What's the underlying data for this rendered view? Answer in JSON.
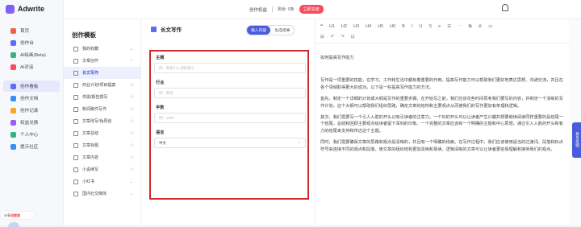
{
  "app": {
    "name": "Adwrite"
  },
  "sidebar": {
    "items": [
      {
        "label": "首页",
        "color": "#f0623f"
      },
      {
        "label": "创作台",
        "color": "#5b6cf6"
      },
      {
        "label": "AI绘画(Beta)",
        "color": "#36b37e"
      },
      {
        "label": "AI对话",
        "color": "#f64c5c"
      },
      {
        "label": "创作看板",
        "color": "#5b6cf6"
      },
      {
        "label": "创作文档",
        "color": "#3a8df6"
      },
      {
        "label": "创作记录",
        "color": "#f5a623"
      },
      {
        "label": "权益兑换",
        "color": "#9c5bf6"
      },
      {
        "label": "个人中心",
        "color": "#36b37e"
      },
      {
        "label": "提示社区",
        "color": "#3a8df6"
      }
    ],
    "promo": {
      "prefix": "分享",
      "highlight": "送额度"
    }
  },
  "topbar": {
    "rights_label": "创作权益",
    "remaining_label": "剩余",
    "remaining_value": "0条",
    "cta": "立即充值"
  },
  "templates": {
    "title": "创作模板",
    "items": [
      {
        "label": "我的收藏",
        "type": "fav"
      },
      {
        "label": "文章创作",
        "type": "group"
      },
      {
        "label": "长文写作",
        "type": "active"
      },
      {
        "label": "商业计划/项目提案",
        "type": "star"
      },
      {
        "label": "供需/报告撰写",
        "type": "star"
      },
      {
        "label": "新闻稿件写作",
        "type": "star"
      },
      {
        "label": "文章改写/伪原创",
        "type": "star"
      },
      {
        "label": "文章总结",
        "type": "star"
      },
      {
        "label": "文章标题",
        "type": "star"
      },
      {
        "label": "文章内容",
        "type": "star"
      },
      {
        "label": "小说续写",
        "type": "star"
      },
      {
        "label": "小红书",
        "type": "group"
      },
      {
        "label": "国内社交媒体",
        "type": "group"
      }
    ]
  },
  "form": {
    "title": "长文写作",
    "tabs": [
      "输入内容",
      "生成结果"
    ],
    "fields": [
      {
        "label": "主题",
        "placeholder": "例：教育引入调的意义"
      },
      {
        "label": "行业",
        "placeholder": "例：教育"
      },
      {
        "label": "字数",
        "placeholder": "例：1000"
      },
      {
        "label": "语言",
        "value": "中文"
      }
    ]
  },
  "editor": {
    "toolbar1": [
      "❝",
      "H1",
      "H2",
      "H3",
      "H4",
      "H5",
      "H6",
      "B",
      "I",
      "U",
      "S",
      "≡",
      "☰",
      "⋯",
      "⧉",
      "⊘",
      "▭"
    ],
    "toolbar2": [
      "⊟",
      "↶",
      "↷",
      "⊡"
    ],
    "title": "如何提高写作能力",
    "paragraphs": [
      "写作是一项重要的技能，在学习、工作和生活中都有着重要的作用。提高写作能力可以帮助我们更好地表达思想、沟通交流，并且在各个领域取得更大的成功。以下是一些提高写作能力的方法。",
      "首先，制定一个详细的计划或大纲是写作的重要步骤。在开始写之前，我们应该花些时间思考我们要写的内容，并制定一个清晰的写作计划。这个大纲可以帮助我们组织思路，确定文章的结构和主要观点从而使我们的写作更加有条理和逻辑。",
      "其次，我们需要写一个引人入胜的开头以吸引读者的注意力。一个好的开头可以让读者产生兴趣并想要继续阅读同样重要的是结尾一个结尾，总结和回顾主要观点给读者留下深刻的印象。一个完整的文章应该有一个明确的主题和中心思想，通过引人入胜的开头和有力的结尾来支持和传达这个主题。",
      "同时，我们需要确保文章的思路和观点是清晰的，并且有一个明确的线索。在写作过程中，我们应该使用适当的过渡词、段落和标点符号来连接不同的观点和段落，使文章的组织结构更加清晰和易读。逻辑清晰的文章可以让读者更容易理解和接受我们的观点。"
    ],
    "side_tag": "意见反馈"
  }
}
